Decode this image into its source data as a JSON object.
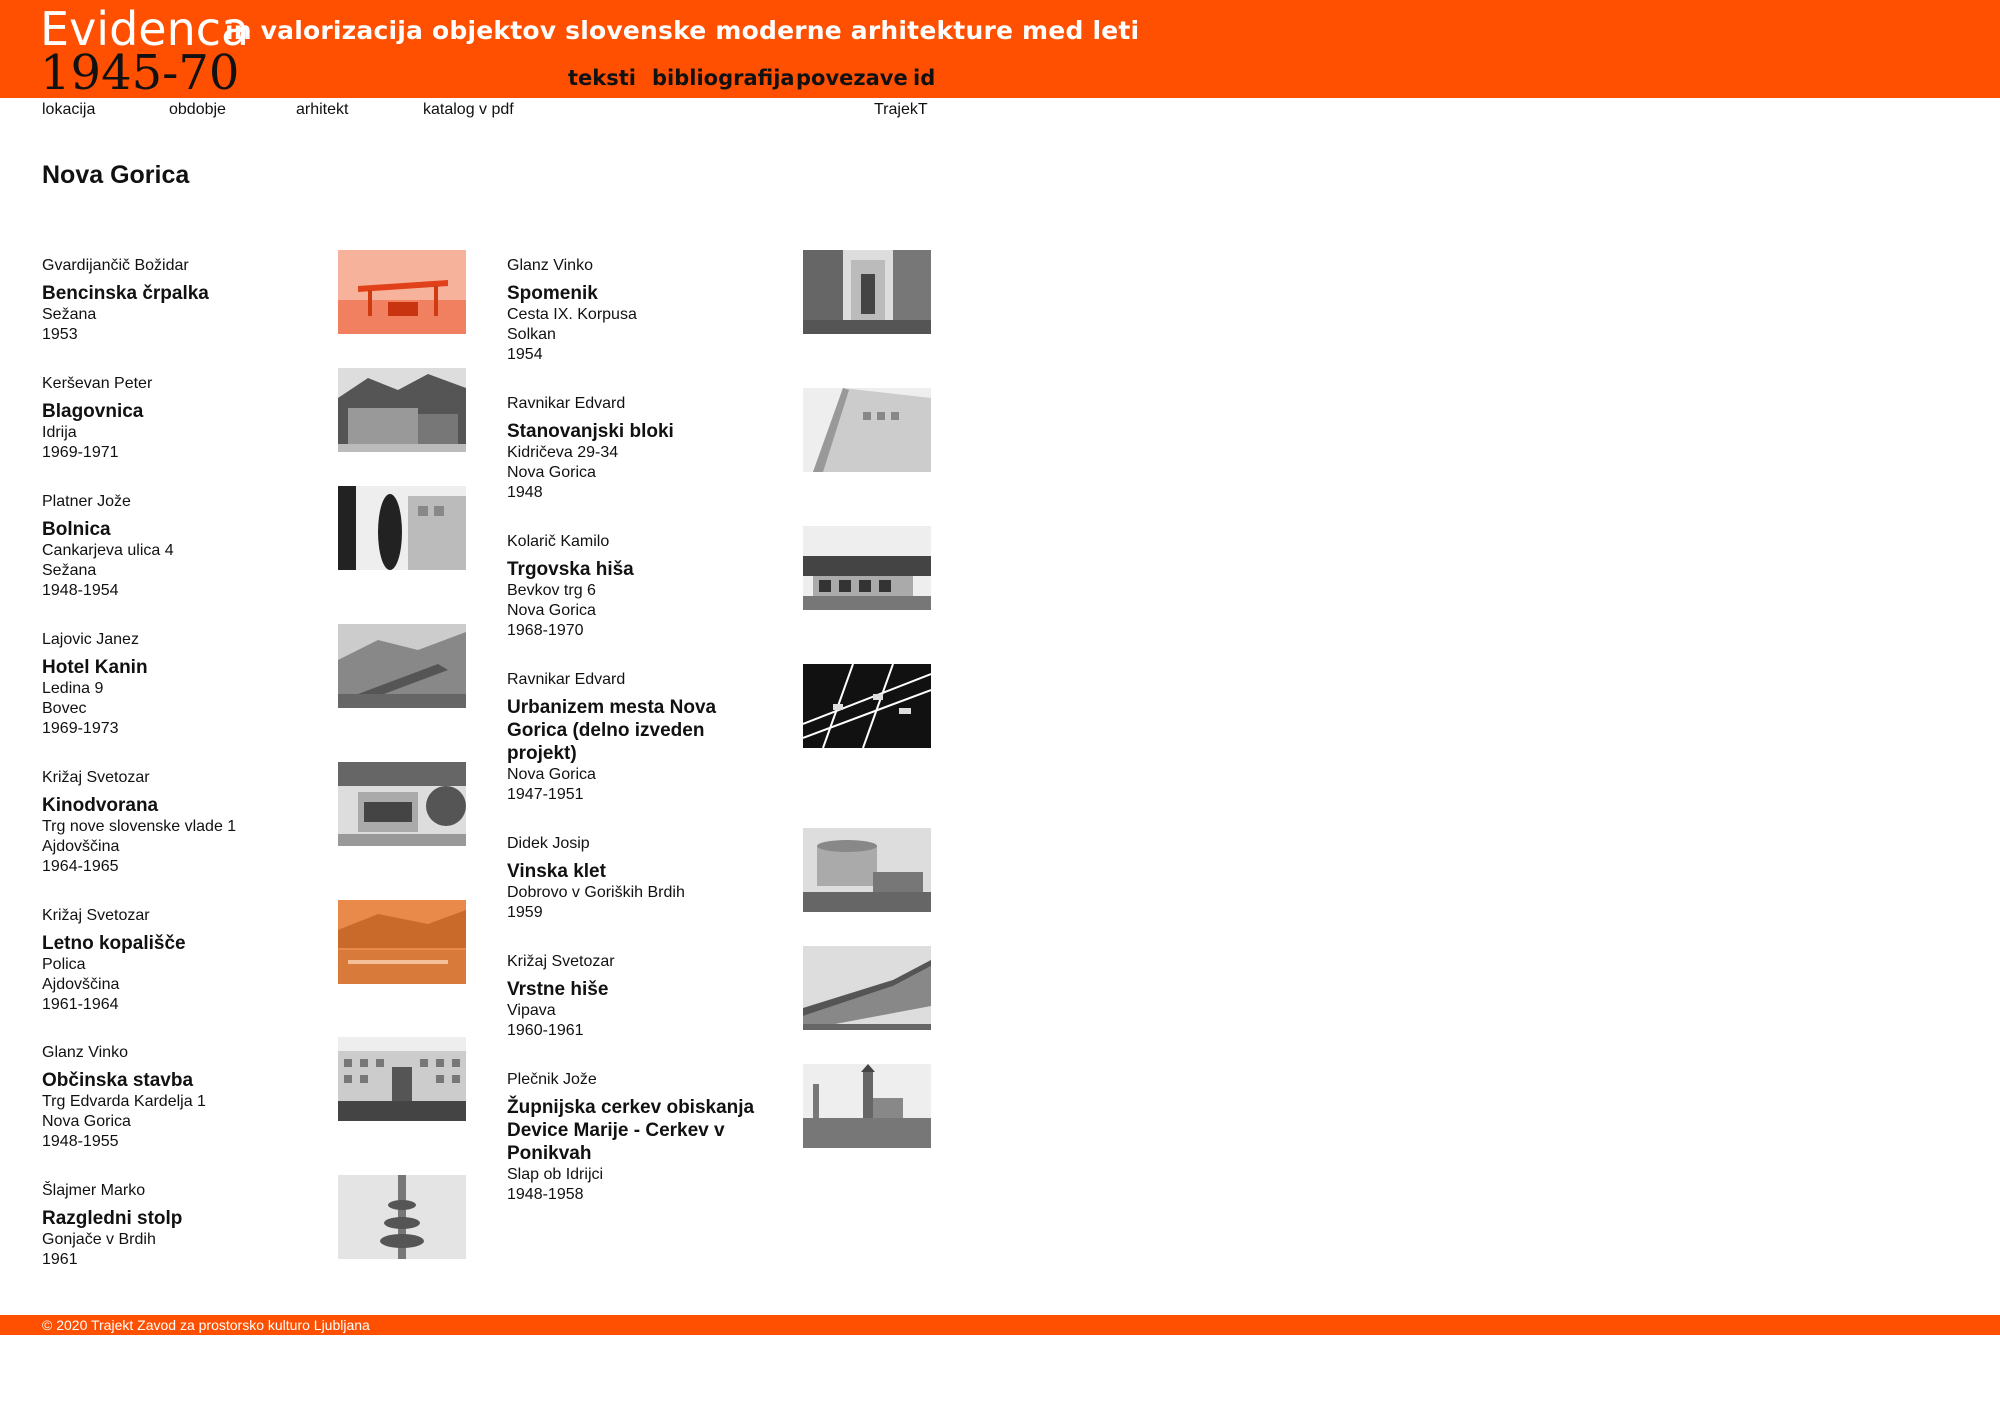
{
  "header": {
    "logo_word": "Evidenca",
    "logo_years": "1945-70",
    "tagline": "in valorizacija objektov slovenske moderne arhitekture med leti",
    "nav": [
      "teksti",
      "bibliografija",
      "povezave",
      "id"
    ]
  },
  "subnav": [
    "lokacija",
    "obdobje",
    "arhitekt",
    "katalog v pdf",
    "TrajekT"
  ],
  "page_title": "Nova Gorica",
  "col1": [
    {
      "author": "Gvardijančič Božidar",
      "name": [
        "Bencinska črpalka"
      ],
      "lines": [
        "Sežana",
        "1953"
      ]
    },
    {
      "author": "Kerševan Peter",
      "name": [
        "Blagovnica"
      ],
      "lines": [
        "Idrija",
        "1969-1971"
      ]
    },
    {
      "author": "Platner Jože",
      "name": [
        "Bolnica"
      ],
      "lines": [
        "Cankarjeva ulica 4",
        "Sežana",
        "1948-1954"
      ]
    },
    {
      "author": "Lajovic Janez",
      "name": [
        "Hotel Kanin"
      ],
      "lines": [
        "Ledina 9",
        "Bovec",
        "1969-1973"
      ]
    },
    {
      "author": "Križaj Svetozar",
      "name": [
        "Kinodvorana"
      ],
      "lines": [
        "Trg nove slovenske vlade 1",
        "Ajdovščina",
        "1964-1965"
      ]
    },
    {
      "author": "Križaj Svetozar",
      "name": [
        "Letno kopališče"
      ],
      "lines": [
        "Polica",
        "Ajdovščina",
        "1961-1964"
      ]
    },
    {
      "author": "Glanz Vinko",
      "name": [
        "Občinska stavba"
      ],
      "lines": [
        "Trg Edvarda Kardelja 1",
        "Nova Gorica",
        "1948-1955"
      ]
    },
    {
      "author": "Šlajmer Marko",
      "name": [
        "Razgledni stolp"
      ],
      "lines": [
        "Gonjače v Brdih",
        "1961"
      ]
    }
  ],
  "col2": [
    {
      "author": "Glanz Vinko",
      "name": [
        "Spomenik"
      ],
      "lines": [
        "Cesta IX. Korpusa",
        "Solkan",
        "1954"
      ]
    },
    {
      "author": "Ravnikar Edvard",
      "name": [
        "Stanovanjski bloki"
      ],
      "lines": [
        "Kidričeva 29-34",
        "Nova Gorica",
        "1948"
      ]
    },
    {
      "author": "Kolarič Kamilo",
      "name": [
        "Trgovska hiša"
      ],
      "lines": [
        "Bevkov trg 6",
        "Nova Gorica",
        "1968-1970"
      ]
    },
    {
      "author": "Ravnikar Edvard",
      "name": [
        "Urbanizem mesta Nova",
        "Gorica (delno izveden",
        "projekt)"
      ],
      "lines": [
        "Nova Gorica",
        "1947-1951"
      ]
    },
    {
      "author": "Didek Josip",
      "name": [
        "Vinska klet"
      ],
      "lines": [
        "Dobrovo v Goriških Brdih",
        "1959"
      ]
    },
    {
      "author": "Križaj Svetozar",
      "name": [
        "Vrstne hiše"
      ],
      "lines": [
        "Vipava",
        "1960-1961"
      ]
    },
    {
      "author": "Plečnik Jože",
      "name": [
        "Župnijska cerkev obiskanja",
        "Device Marije - Cerkev v",
        "Ponikvah"
      ],
      "lines": [
        "Slap ob Idrijci",
        "1948-1958"
      ]
    }
  ],
  "footer": "© 2020 Trajekt Zavod za prostorsko kulturo Ljubljana",
  "colors": {
    "brand_orange": "#ff4f00",
    "text": "#111111"
  }
}
